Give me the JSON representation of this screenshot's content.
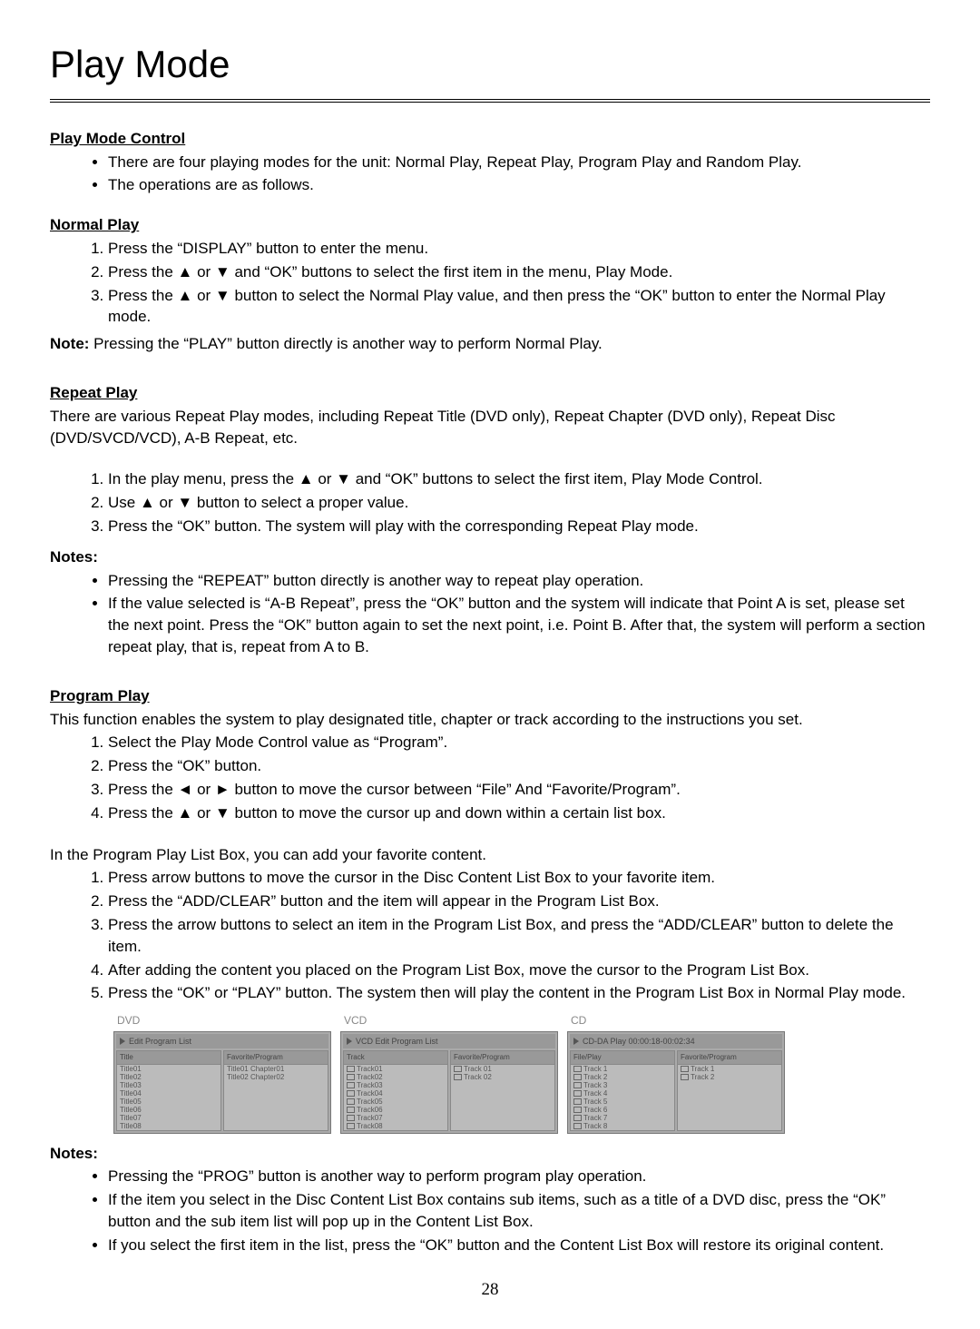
{
  "page_title": "Play Mode",
  "page_number": "28",
  "play_mode_control": {
    "heading": "Play Mode Control",
    "bullets": [
      "There are four playing modes for the unit: Normal Play, Repeat Play, Program Play and Random Play.",
      "The operations are as follows."
    ]
  },
  "normal_play": {
    "heading": "Normal Play",
    "steps": [
      "Press the “DISPLAY” button to enter the menu.",
      "Press the ▲ or ▼ and “OK” buttons to select the first item in the menu, Play Mode.",
      "Press the ▲ or ▼ button to select the Normal Play value, and then press the “OK” button to enter the Normal Play mode."
    ],
    "note_label": "Note:",
    "note_text": " Pressing the “PLAY” button directly is another way to perform Normal Play."
  },
  "repeat_play": {
    "heading": "Repeat Play",
    "intro": "There are various Repeat Play modes, including Repeat Title (DVD only), Repeat Chapter (DVD only), Repeat Disc (DVD/SVCD/VCD), A-B Repeat, etc.",
    "steps": [
      "In the play menu, press the ▲ or ▼ and “OK” buttons to select the first item, Play Mode Control.",
      "Use ▲ or ▼ button to select a proper value.",
      "Press the “OK” button.  The system will play with the corresponding Repeat Play mode."
    ],
    "notes_label": "Notes:",
    "notes": [
      "Pressing the “REPEAT” button directly is another way to repeat play operation.",
      "If the value selected is “A-B Repeat”, press the “OK” button and the system will indicate that Point A is set, please set the next point. Press the “OK” button again to set the next point, i.e. Point B. After that, the system will perform a section repeat play, that is, repeat from A to B."
    ]
  },
  "program_play": {
    "heading": "Program Play",
    "intro": "This function enables the system to play designated title, chapter or track according to the instructions you set.",
    "steps1": [
      "Select the Play Mode Control value as “Program”.",
      "Press the “OK” button.",
      "Press the ◄ or ► button to move the cursor between “File” And “Favorite/Program”.",
      "Press the ▲ or ▼ button to move the cursor up and down within a certain list box."
    ],
    "mid_text": "In the Program Play List Box, you can add your favorite content.",
    "steps2": [
      "Press arrow buttons to move the cursor in the Disc Content List Box to your favorite item.",
      "Press the “ADD/CLEAR” button and the item will appear in the Program List Box.",
      "Press the arrow buttons to select an item in the Program List Box, and press the “ADD/CLEAR” button to delete the item.",
      "After adding the content you placed on the Program List Box, move the cursor to the Program List Box.",
      "Press the “OK” or “PLAY” button.  The system then will play the content in the Program List Box in Normal Play mode."
    ],
    "notes_label": "Notes:",
    "notes": [
      "Pressing the “PROG” button is another way to perform program play operation.",
      "If the item you select in the Disc Content List Box contains sub items, such as a title of a DVD disc, press the “OK” button and the sub item list will pop up in the Content List Box.",
      "If you select the first item in the list, press the “OK” button and the Content List Box will restore its original content."
    ]
  },
  "screens": {
    "dvd": {
      "label": "DVD",
      "header": "Edit Program List",
      "left_header": "Title",
      "right_header": "Favorite/Program",
      "left": [
        "Title01",
        "Title02",
        "Title03",
        "Title04",
        "Title05",
        "Title06",
        "Title07",
        "Title08"
      ],
      "right": [
        "Title01 Chapter01",
        "Title02 Chapter02"
      ]
    },
    "vcd": {
      "label": "VCD",
      "header": "VCD Edit Program List",
      "left_header": "Track",
      "right_header": "Favorite/Program",
      "left": [
        "Track01",
        "Track02",
        "Track03",
        "Track04",
        "Track05",
        "Track06",
        "Track07",
        "Track08"
      ],
      "right": [
        "Track 01",
        "Track 02"
      ]
    },
    "cd": {
      "label": "CD",
      "header": "CD-DA      Play 00:00:18-00:02:34",
      "left_header": "File/Play",
      "right_header": "Favorite/Program",
      "left": [
        "Track 1",
        "Track 2",
        "Track 3",
        "Track 4",
        "Track 5",
        "Track 6",
        "Track 7",
        "Track 8"
      ],
      "right": [
        "Track 1",
        "Track 2"
      ]
    }
  }
}
